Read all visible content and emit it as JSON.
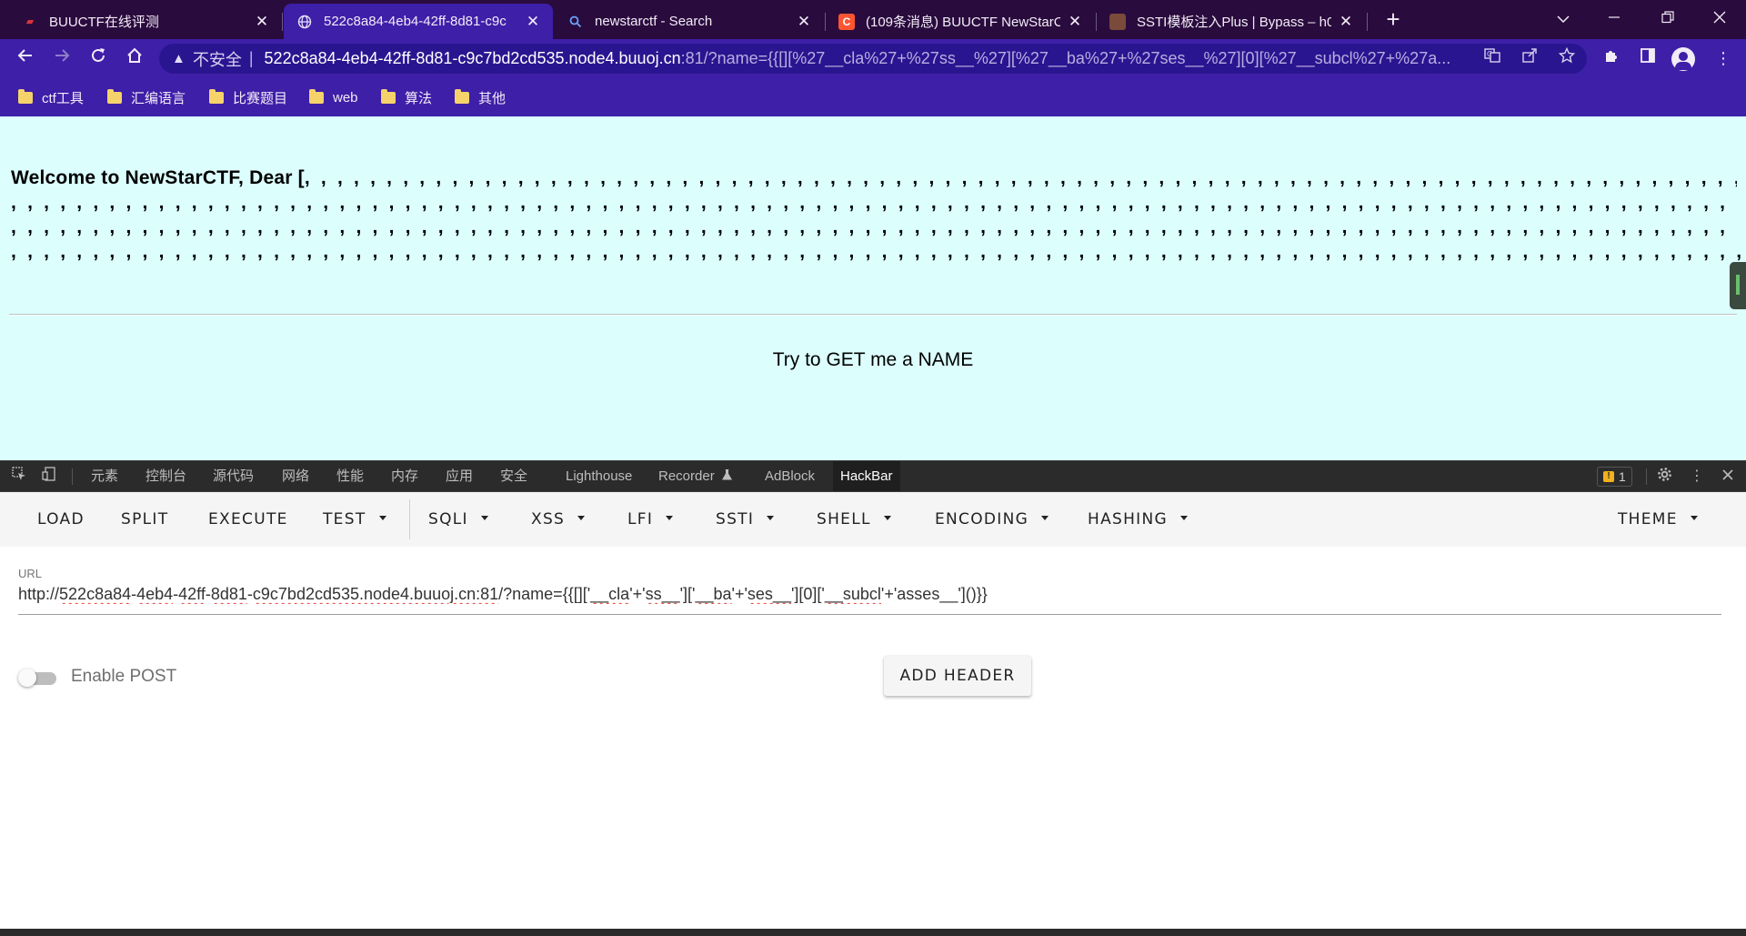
{
  "browser": {
    "tabs": [
      {
        "title": "BUUCTF在线评测",
        "icon": "buuctf-icon",
        "active": false
      },
      {
        "title": "522c8a84-4eb4-42ff-8d81-c9c",
        "icon": "globe-icon",
        "active": true
      },
      {
        "title": "newstarctf - Search",
        "icon": "search-icon",
        "active": false
      },
      {
        "title": "(109条消息) BUUCTF NewStarC",
        "icon": "csdn-icon",
        "active": false
      },
      {
        "title": "SSTI模板注入Plus | Bypass – h0",
        "icon": "avatar-icon",
        "active": false
      }
    ],
    "address": {
      "insecure_label": "不安全",
      "host": "522c8a84-4eb4-42ff-8d81-c9c7bd2cd535.node4.buuoj.cn",
      "rest": ":81/?name={{[][%27__cla%27+%27ss__%27][%27__ba%27+%27ses__%27][0][%27__subcl%27+%27a..."
    },
    "bookmarks": [
      "ctf工具",
      "汇编语言",
      "比赛题目",
      "web",
      "算法",
      "其他"
    ]
  },
  "page": {
    "welcome_label": "Welcome to NewStarCTF, Dear [",
    "commas_line1": ", , , , , , , , , , , , , , , , , , , , , , , , , , , , , , , , , , , , , , , , , , , , , , , , , , , , , , , , , , , , , , , , , , , , , , , , , , , , , , , , , , , , , , , , , , , , , , , , , , , , , , , , ,",
    "commas_line2": ", , , , , , , , , , , , , , , , , , , , , , , , , , , , , , , , , , , , , , , , , , , , , , , , , , , , , , , , , , , , , , , , , , , , , , , , , , , , , , , , , , , , , , , , , , , , , , , , , , , , , , , , , , , , , , , , , , , , , , , , , , , , , , , ,",
    "commas_line3": ", , , , , , , , , , , , , , , , , , , , , , , , , , , , , , , , , , , , , , , , , , , , , , , , , , , , , , , , , , , , , , , , , , , , , , , , , , , , , , , , , , , , , , , , , , , , , , , , , , , , , , , , , , , , , , , , , , , , , , , , , , , , , , , , ,",
    "commas_line4": ", , , , , , , , , , , , , , , , , , , , , , , , , , , , , , , , , , , , , , , , , , , , , , , , , , , , , , , , , , , , , , , , , , , , , , , , , , , , , , , , , , , , , , , , , , , , , , , , , , , , , , , , , , , , , , , , , ,",
    "welcome_close": "]",
    "hint": "Try to GET me a NAME"
  },
  "devtools": {
    "tabs": [
      "元素",
      "控制台",
      "源代码",
      "网络",
      "性能",
      "内存",
      "应用",
      "安全",
      "Lighthouse",
      "Recorder",
      "AdBlock",
      "HackBar"
    ],
    "active_tab": "HackBar",
    "issues_count": "1"
  },
  "hackbar": {
    "menu": {
      "load": "LOAD",
      "split": "SPLIT",
      "execute": "EXECUTE",
      "test": "TEST",
      "sqli": "SQLI",
      "xss": "XSS",
      "lfi": "LFI",
      "ssti": "SSTI",
      "shell": "SHELL",
      "encoding": "ENCODING",
      "hashing": "HASHING",
      "theme": "THEME"
    },
    "url_label": "URL",
    "url_parts": {
      "scheme": "http://",
      "p1": "522c8a84",
      "d1": "-",
      "p2": "4eb4",
      "d2": "-",
      "p3": "42ff",
      "d3": "-",
      "p4": "8d81",
      "d4": "-",
      "p5": "c9c7bd2cd535.node4.buuoj.cn:81",
      "q1": "/?name={{[]['",
      "s1": "__cla",
      "q2": "'+'",
      "s2": "ss__",
      "q3": "']['",
      "s3": "__ba",
      "q4": "'+'",
      "s4": "ses__",
      "q5": "'][0]['",
      "s5": "__subcl",
      "q6": "'+'asses__']()}}"
    },
    "enable_post_label": "Enable POST",
    "enable_post": false,
    "add_header_label": "ADD HEADER"
  }
}
